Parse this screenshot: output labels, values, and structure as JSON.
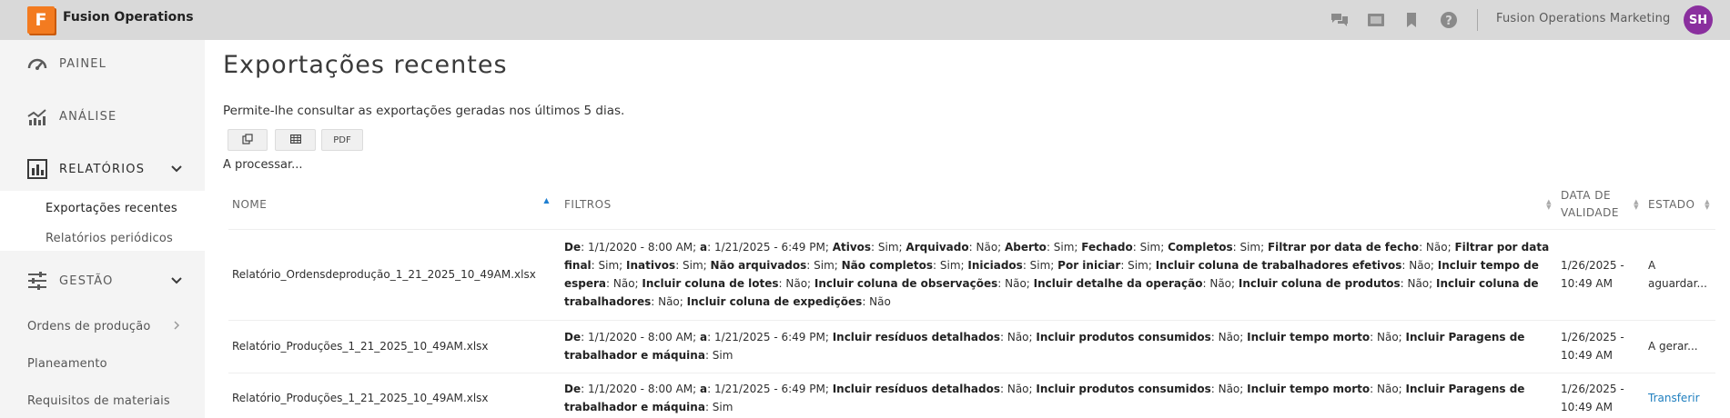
{
  "app": {
    "logo_letter": "F",
    "title": "Fusion Operations"
  },
  "topbar": {
    "icons": [
      "chat-icon",
      "screen-icon",
      "bookmark-icon",
      "help-icon"
    ],
    "account_name": "Fusion Operations Marketing",
    "avatar_initials": "SH"
  },
  "sidebar": {
    "painel": "PAINEL",
    "analise": "ANÁLISE",
    "relatorios": "RELATÓRIOS",
    "exportacoes": "Exportações recentes",
    "periodicos": "Relatórios periódicos",
    "gestao": "GESTÃO",
    "ordens": "Ordens de produção",
    "planeamento": "Planeamento",
    "requisitos": "Requisitos de materiais"
  },
  "main": {
    "title": "Exportações recentes",
    "description": "Permite-lhe consultar as exportações geradas nos últimos 5 dias.",
    "pdf_label": "PDF",
    "processing": "A processar..."
  },
  "table": {
    "headers": {
      "nome": "NOME",
      "filtros": "FILTROS",
      "validade": "DATA DE VALIDADE",
      "estado": "ESTADO"
    },
    "rows": [
      {
        "nome": "Relatório_Ordensdeprodução_1_21_2025_10_49AM.xlsx",
        "filtros": [
          [
            "De",
            ": 1/1/2020 - 8:00 AM; "
          ],
          [
            "a",
            ": 1/21/2025 - 6:49 PM; "
          ],
          [
            "Ativos",
            ": Sim; "
          ],
          [
            "Arquivado",
            ": Não; "
          ],
          [
            "Aberto",
            ": Sim; "
          ],
          [
            "Fechado",
            ": Sim; "
          ],
          [
            "Completos",
            ": Sim; "
          ],
          [
            "Filtrar por data de fecho",
            ": Não; "
          ],
          [
            "Filtrar por data final",
            ": Sim; "
          ],
          [
            "Inativos",
            ": Sim; "
          ],
          [
            "Não arquivados",
            ": Sim; "
          ],
          [
            "Não completos",
            ": Sim; "
          ],
          [
            "Iniciados",
            ": Sim; "
          ],
          [
            "Por iniciar",
            ": Sim; "
          ],
          [
            "Incluir coluna de trabalhadores efetivos",
            ": Não; "
          ],
          [
            "Incluir tempo de espera",
            ": Não; "
          ],
          [
            "Incluir coluna de lotes",
            ": Não; "
          ],
          [
            "Incluir coluna de observações",
            ": Não; "
          ],
          [
            "Incluir detalhe da operação",
            ": Não; "
          ],
          [
            "Incluir coluna de produtos",
            ": Não; "
          ],
          [
            "Incluir coluna de trabalhadores",
            ": Não; "
          ],
          [
            "Incluir coluna de expedições",
            ": Não"
          ]
        ],
        "validade": "1/26/2025 - 10:49 AM",
        "estado": "A aguardar...",
        "estado_link": false
      },
      {
        "nome": "Relatório_Produções_1_21_2025_10_49AM.xlsx",
        "filtros": [
          [
            "De",
            ": 1/1/2020 - 8:00 AM; "
          ],
          [
            "a",
            ": 1/21/2025 - 6:49 PM; "
          ],
          [
            "Incluir resíduos detalhados",
            ": Não; "
          ],
          [
            "Incluir produtos consumidos",
            ": Não; "
          ],
          [
            "Incluir tempo morto",
            ": Não; "
          ],
          [
            "Incluir Paragens de trabalhador e máquina",
            ": Sim"
          ]
        ],
        "validade": "1/26/2025 - 10:49 AM",
        "estado": "A gerar...",
        "estado_link": false
      },
      {
        "nome": "Relatório_Produções_1_21_2025_10_49AM.xlsx",
        "filtros": [
          [
            "De",
            ": 1/1/2020 - 8:00 AM; "
          ],
          [
            "a",
            ": 1/21/2025 - 6:49 PM; "
          ],
          [
            "Incluir resíduos detalhados",
            ": Não; "
          ],
          [
            "Incluir produtos consumidos",
            ": Não; "
          ],
          [
            "Incluir tempo morto",
            ": Não; "
          ],
          [
            "Incluir Paragens de trabalhador e máquina",
            ": Sim"
          ]
        ],
        "validade": "1/26/2025 - 10:49 AM",
        "estado": "Transferir",
        "estado_link": true
      }
    ]
  }
}
